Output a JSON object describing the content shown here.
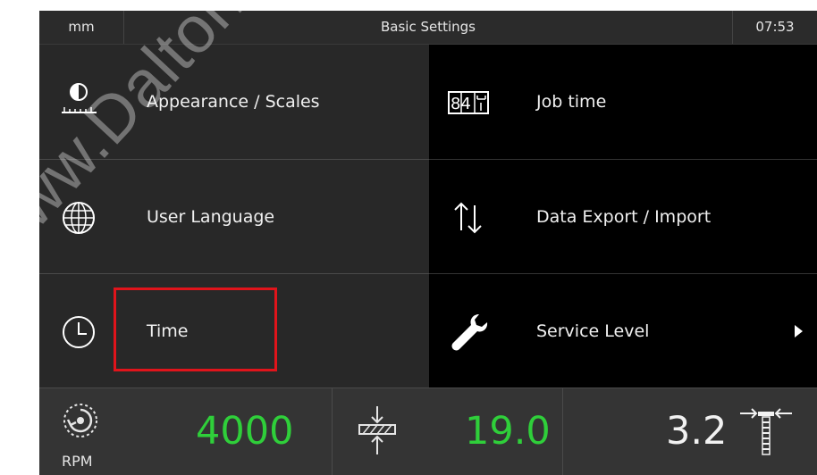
{
  "statusbar": {
    "unit": "mm",
    "title": "Basic Settings",
    "time": "07:53"
  },
  "menu": {
    "appearance": {
      "label": "Appearance / Scales",
      "icon": "contrast-scale-icon"
    },
    "job_time": {
      "label": "Job time",
      "icon": "counter-icon",
      "counter_digits": "84"
    },
    "language": {
      "label": "User Language",
      "icon": "globe-icon"
    },
    "data_export": {
      "label": "Data Export / Import",
      "icon": "up-down-arrows-icon"
    },
    "time": {
      "label": "Time",
      "icon": "clock-icon"
    },
    "service": {
      "label": "Service Level",
      "icon": "wrench-icon"
    }
  },
  "bottom": {
    "rpm": {
      "value": "4000",
      "label": "RPM",
      "icon": "rotation-gauge-icon"
    },
    "position": {
      "value": "19.0",
      "icon": "compress-arrows-icon"
    },
    "dimension": {
      "value": "3.2",
      "icon": "squeeze-arrows-icon"
    }
  },
  "watermark": "www.DaltonsWadkin",
  "colors": {
    "highlight": "#e0141b",
    "value_green": "#2fcf3a"
  }
}
